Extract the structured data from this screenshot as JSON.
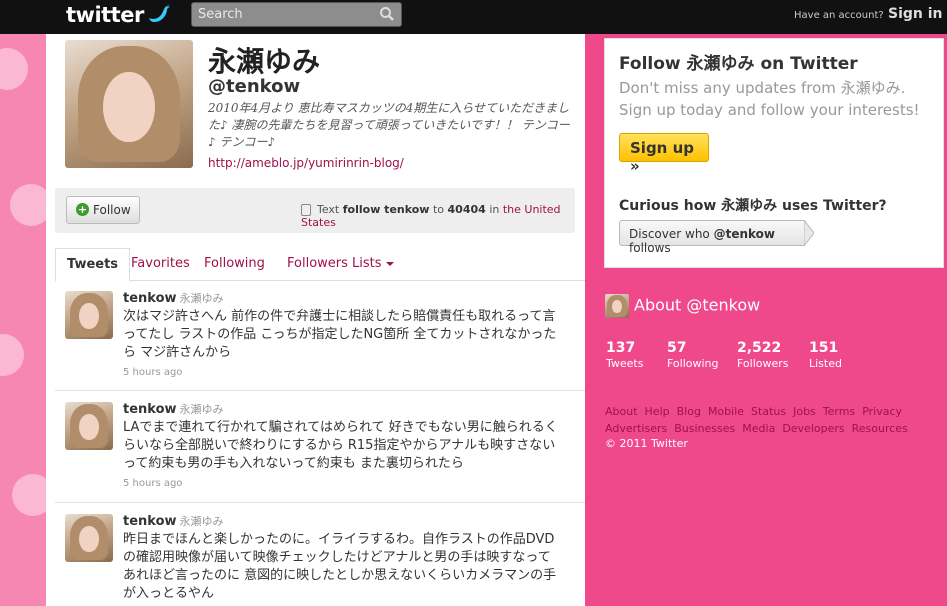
{
  "header": {
    "logo": "twitter",
    "search_placeholder": "Search",
    "have_account": "Have an account?",
    "signin": "Sign in"
  },
  "profile": {
    "name": "永瀬ゆみ",
    "handle": "@tenkow",
    "bio": "2010年4月より 恵比寿マスカッツの4期生に入らせていただきました♪ 凄腕の先輩たちを見習って頑張っていきたいです！！ テンコー♪ テンコー♪",
    "url": "http://ameblo.jp/yumirinrin-blog/"
  },
  "followbar": {
    "follow_label": "Follow",
    "sms_prefix": "Text",
    "sms_command": "follow tenkow",
    "sms_to": "to",
    "sms_number": "40404",
    "sms_in": "in",
    "sms_country": "the United States"
  },
  "tabs": [
    {
      "label": "Tweets"
    },
    {
      "label": "Favorites"
    },
    {
      "label": "Following"
    },
    {
      "label": "Followers"
    },
    {
      "label": "Lists"
    }
  ],
  "tweets": [
    {
      "user": "tenkow",
      "name": "永瀬ゆみ",
      "text": "次はマジ許さへん 前作の件で弁護士に相談したら賠償責任も取れるって言ってたし ラストの作品 こっちが指定したNG箇所 全てカットされなかったら マジ許さんから",
      "time": "5 hours ago"
    },
    {
      "user": "tenkow",
      "name": "永瀬ゆみ",
      "text": "LAでまで連れて行かれて騙されてはめられて 好きでもない男に触られるくらいなら全部脱いで終わりにするから R15指定やからアナルも映すさないって約束も男の手も入れないって約束も また裏切られたら",
      "time": "5 hours ago"
    },
    {
      "user": "tenkow",
      "name": "永瀬ゆみ",
      "text": "昨日までほんと楽しかったのに。イライラするわ。自作ラストの作品DVDの確認用映像が届いて映像チェックしたけどアナルと男の手は映すなってあれほど言ったのに 意図的に映したとしか思えないくらいカメラマンの手が入っとるやん",
      "time": ""
    }
  ],
  "sidebar": {
    "title": "Follow 永瀬ゆみ on Twitter",
    "subtitle": "Don't miss any updates from 永瀬ゆみ. Sign up today and follow your interests!",
    "signup": "Sign up »",
    "curious": "Curious how 永瀬ゆみ uses Twitter?",
    "discover_pre": "Discover who",
    "discover_handle": "@tenkow",
    "discover_post": "follows"
  },
  "about": {
    "title": "About @tenkow",
    "stats": [
      {
        "value": "137",
        "label": "Tweets"
      },
      {
        "value": "57",
        "label": "Following"
      },
      {
        "value": "2,522",
        "label": "Followers"
      },
      {
        "value": "151",
        "label": "Listed"
      }
    ]
  },
  "footer": {
    "links": [
      "About",
      "Help",
      "Blog",
      "Mobile",
      "Status",
      "Jobs",
      "Terms",
      "Privacy",
      "Advertisers",
      "Businesses",
      "Media",
      "Developers",
      "Resources"
    ],
    "copyright": "© 2011 Twitter"
  },
  "colors": {
    "background": "#f0498b",
    "link": "#a0114b",
    "signup": "#ffc000"
  }
}
